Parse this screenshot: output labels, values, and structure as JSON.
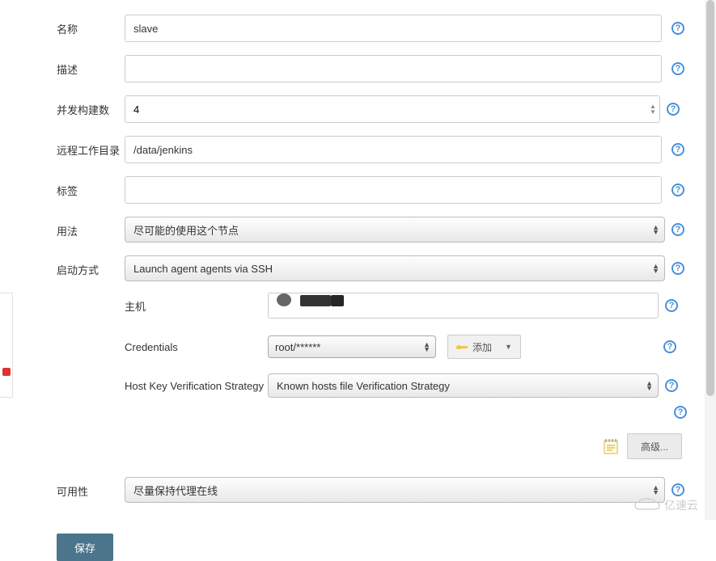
{
  "form": {
    "name": {
      "label": "名称",
      "value": "slave"
    },
    "description": {
      "label": "描述",
      "value": ""
    },
    "executors": {
      "label": "并发构建数",
      "value": "4"
    },
    "remote_fs": {
      "label": "远程工作目录",
      "value": "/data/jenkins"
    },
    "labels": {
      "label": "标签",
      "value": ""
    },
    "usage": {
      "label": "用法",
      "selected": "尽可能的使用这个节点"
    },
    "launch": {
      "label": "启动方式",
      "selected": "Launch agent agents via SSH"
    },
    "ssh": {
      "host_label": "主机",
      "credentials_label": "Credentials",
      "credentials_selected": "root/******",
      "add_label": "添加",
      "hostkey_label": "Host Key Verification Strategy",
      "hostkey_selected": "Known hosts file Verification Strategy"
    },
    "advanced_label": "高级...",
    "availability": {
      "label": "可用性",
      "selected": "尽量保持代理在线"
    },
    "save_label": "保存"
  },
  "watermark": "亿速云"
}
